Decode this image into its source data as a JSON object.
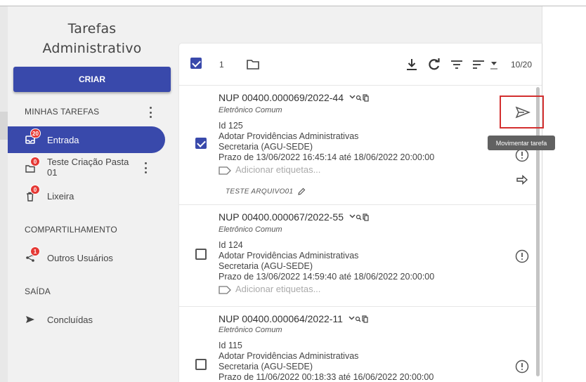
{
  "sidebar": {
    "title_line1": "Tarefas",
    "title_line2": "Administrativo",
    "create_label": "CRIAR",
    "sections": {
      "my_tasks": "MINHAS TAREFAS",
      "sharing": "COMPARTILHAMENTO",
      "output": "SAÍDA"
    },
    "items": {
      "inbox": {
        "label": "Entrada",
        "badge": "20"
      },
      "folder": {
        "label_line1": "Teste Criação Pasta",
        "label_line2": "01",
        "badge": "0"
      },
      "trash": {
        "label": "Lixeira",
        "badge": "0"
      },
      "others": {
        "label": "Outros Usuários",
        "badge": "1"
      },
      "done": {
        "label": "Concluídas"
      }
    }
  },
  "toolbar": {
    "selected_count": "1",
    "pagination": "10/20"
  },
  "tasks": [
    {
      "nup": "NUP 00400.000069/2022-44",
      "kind": "Eletrônico Comum",
      "id": "Id 125",
      "title": "Adotar Providências Administrativas",
      "unit": "Secretaria (AGU-SEDE)",
      "deadline": "Prazo de 13/06/2022 16:45:14 até 18/06/2022 20:00:00",
      "tags_placeholder": "Adicionar etiquetas...",
      "attachment": "TESTE ARQUIVO01",
      "checked": true
    },
    {
      "nup": "NUP 00400.000067/2022-55",
      "kind": "Eletrônico Comum",
      "id": "Id 124",
      "title": "Adotar Providências Administrativas",
      "unit": "Secretaria (AGU-SEDE)",
      "deadline": "Prazo de 13/06/2022 14:59:40 até 18/06/2022 20:00:00",
      "tags_placeholder": "Adicionar etiquetas...",
      "checked": false
    },
    {
      "nup": "NUP 00400.000064/2022-11",
      "kind": "Eletrônico Comum",
      "id": "Id 115",
      "title": "Adotar Providências Administrativas",
      "unit": "Secretaria (AGU-SEDE)",
      "deadline": "Prazo de 11/06/2022 00:18:33 até 16/06/2022 20:00:00",
      "checked": false
    }
  ],
  "tooltip": "Movimentar tarefa",
  "colors": {
    "accent": "#3949ab",
    "badge": "#e53935",
    "highlight": "#d32f2f"
  }
}
